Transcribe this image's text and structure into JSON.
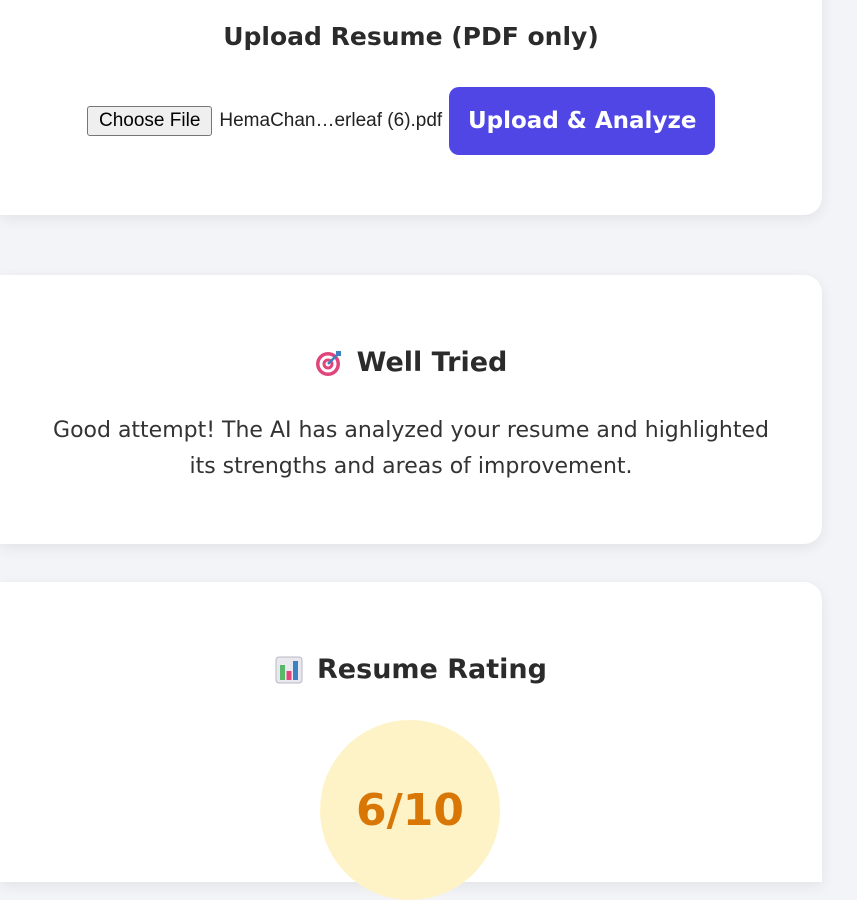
{
  "upload": {
    "title": "Upload Resume (PDF only)",
    "choose_file_label": "Choose File",
    "file_name": "HemaChan…erleaf (6).pdf",
    "upload_button_label": "Upload & Analyze"
  },
  "status": {
    "heading": "Well Tried",
    "icon": "target-icon",
    "message": "Good attempt! The AI has analyzed your resume and highlighted its strengths and areas of improvement."
  },
  "rating": {
    "heading": "Resume Rating",
    "icon": "bar-chart-icon",
    "value": "6/10"
  },
  "colors": {
    "accent": "#4f46e5",
    "rating_bg": "#fef3c7",
    "rating_text": "#d97706"
  }
}
